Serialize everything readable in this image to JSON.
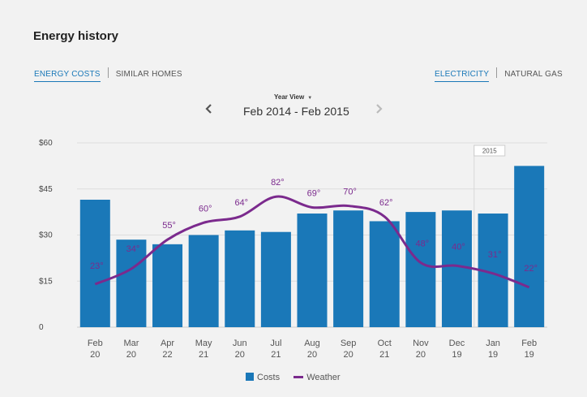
{
  "page": {
    "title": "Energy history"
  },
  "tabs_left": [
    {
      "label": "ENERGY COSTS",
      "active": true
    },
    {
      "label": "SIMILAR HOMES",
      "active": false
    }
  ],
  "tabs_right": [
    {
      "label": "ELECTRICITY",
      "active": true
    },
    {
      "label": "NATURAL GAS",
      "active": false
    }
  ],
  "view_select": {
    "label": "Year View"
  },
  "date_range": "Feb 2014 - Feb 2015",
  "icons": {
    "prev": "chevron-left-icon",
    "next": "chevron-right-icon",
    "dropdown": "caret-down-icon"
  },
  "colors": {
    "bars": "#1a78b8",
    "weather_line": "#7b2a8d",
    "accent": "#1a78b8"
  },
  "chart_data": {
    "type": "bar",
    "categories": [
      [
        "Feb",
        "20"
      ],
      [
        "Mar",
        "20"
      ],
      [
        "Apr",
        "22"
      ],
      [
        "May",
        "21"
      ],
      [
        "Jun",
        "20"
      ],
      [
        "Jul",
        "21"
      ],
      [
        "Aug",
        "20"
      ],
      [
        "Sep",
        "20"
      ],
      [
        "Oct",
        "21"
      ],
      [
        "Nov",
        "20"
      ],
      [
        "Dec",
        "19"
      ],
      [
        "Jan",
        "19"
      ],
      [
        "Feb",
        "19"
      ]
    ],
    "y_ticks": [
      "$60",
      "$45",
      "$30",
      "$15",
      "0"
    ],
    "ylim": [
      0,
      60
    ],
    "grid": true,
    "series": [
      {
        "name": "Costs",
        "type": "bar",
        "values": [
          41.5,
          28.5,
          27,
          30,
          31.5,
          31,
          37,
          38,
          34.5,
          37.5,
          38,
          37,
          52.5
        ]
      },
      {
        "name": "Weather",
        "type": "line",
        "values": [
          23,
          34,
          55,
          60,
          64,
          82,
          69,
          70,
          62,
          48,
          40,
          31,
          22
        ],
        "labels": [
          "23°",
          "34°",
          "55°",
          "60°",
          "64°",
          "82°",
          "69°",
          "70°",
          "62°",
          "48°",
          "40°",
          "31°",
          "22°"
        ],
        "line_level": [
          14,
          19,
          28.5,
          34,
          36,
          42.5,
          39,
          39.5,
          36,
          21,
          20,
          17.5,
          13
        ]
      }
    ],
    "year_marker": {
      "label": "2015",
      "before_index": 11
    },
    "legend": {
      "position": "bottom-center",
      "items": [
        "Costs",
        "Weather"
      ]
    }
  }
}
